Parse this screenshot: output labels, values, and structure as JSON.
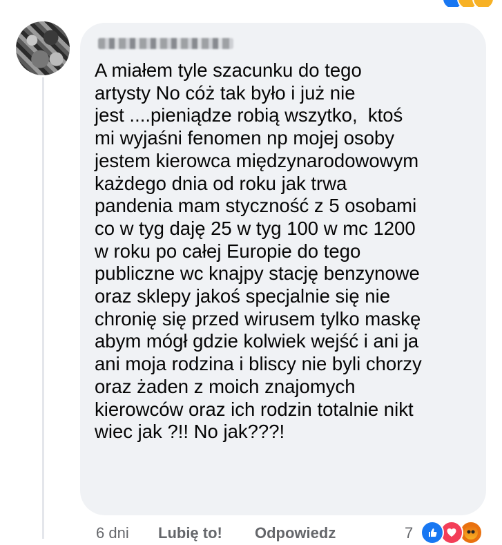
{
  "comment": {
    "author_name": "",
    "lines": [
      "A miałem tyle szacunku do tego",
      "artysty No cóż tak było i już nie",
      "jest ....pieniądze robią wszytko,  ktoś",
      "mi wyjaśni fenomen np mojej osoby",
      "jestem kierowca międzynarodowowym",
      "każdego dnia od roku jak trwa",
      "pandenia mam styczność z 5 osobami",
      "co w tyg daję 25 w tyg 100 w mc 1200",
      "w roku po całej Europie do tego",
      "publiczne wc knajpy stację benzynowe",
      "oraz sklepy jakoś specjalnie się nie",
      "chronię się przed wirusem tylko maskę",
      "abym mógł gdzie kolwiek wejść i ani ja",
      "ani moja rodzina i bliscy nie byli chorzy",
      "oraz żaden z moich znajomych",
      "kierowców oraz ich rodzin totalnie nikt",
      "wiec jak ?!! No jak???!"
    ]
  },
  "actions": {
    "time": "6 dni",
    "like_label": "Lubię to!",
    "reply_label": "Odpowiedz"
  },
  "reactions": {
    "count": "7",
    "types": [
      "like-icon",
      "love-icon",
      "angry-icon"
    ],
    "colors": {
      "like": "#1877f2",
      "love": "#f33e58",
      "angry": "#e9710f"
    }
  },
  "theme": {
    "bubble_bg": "#f0f2f5",
    "text": "#050505",
    "muted": "#65676b"
  }
}
